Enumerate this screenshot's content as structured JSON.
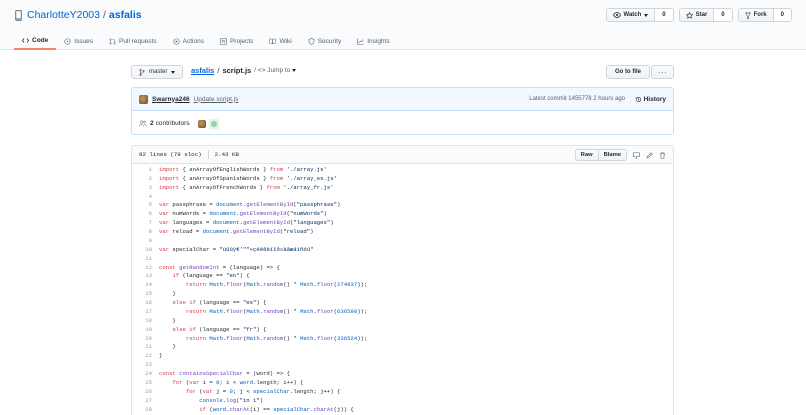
{
  "repo": {
    "owner": "CharlotteY2003",
    "separator": "/",
    "name": "asfalis"
  },
  "header_actions": [
    {
      "label": "Watch",
      "count": "0",
      "icon": "eye-icon",
      "caret": true
    },
    {
      "label": "Star",
      "count": "0",
      "icon": "star-icon",
      "caret": false
    },
    {
      "label": "Fork",
      "count": "0",
      "icon": "fork-icon",
      "caret": false
    }
  ],
  "tabs": [
    {
      "label": "Code",
      "icon": "code-icon",
      "selected": true
    },
    {
      "label": "Issues",
      "icon": "issue-icon",
      "selected": false
    },
    {
      "label": "Pull requests",
      "icon": "pull-request-icon",
      "selected": false
    },
    {
      "label": "Actions",
      "icon": "play-icon",
      "selected": false
    },
    {
      "label": "Projects",
      "icon": "project-icon",
      "selected": false
    },
    {
      "label": "Wiki",
      "icon": "book-icon",
      "selected": false
    },
    {
      "label": "Security",
      "icon": "shield-icon",
      "selected": false
    },
    {
      "label": "Insights",
      "icon": "graph-icon",
      "selected": false
    }
  ],
  "branch": {
    "name": "master"
  },
  "breadcrumb": {
    "repo": "asfalis",
    "sep": "/",
    "file": "script.js",
    "jump": "/ <> Jump to"
  },
  "goto_file": "Go to file",
  "more": "···",
  "commit": {
    "author": "Swarnya246",
    "message": "Update script.js",
    "latest": "Latest commit 1455778 2 hours ago",
    "history": "History"
  },
  "contributors": {
    "count": "2",
    "label": "contributors"
  },
  "file_info": {
    "lines": "92 lines (79 sloc)",
    "size": "2.43 KB"
  },
  "file_buttons": {
    "raw": "Raw",
    "blame": "Blame"
  },
  "code_lines": [
    {
      "n": "1",
      "text": "import { anArrayOfEnglishWords } from './array.js'"
    },
    {
      "n": "2",
      "text": "import { anArrayOfSpanishWords } from './array_es.js'"
    },
    {
      "n": "3",
      "text": "import { anArrayOfFrenchWords } from './array_fr.js'"
    },
    {
      "n": "4",
      "text": ""
    },
    {
      "n": "5",
      "text": "var passphrase = document.getElementById(\"passphrase\")"
    },
    {
      "n": "6",
      "text": "var numWords = document.getElementById(\"numWords\")"
    },
    {
      "n": "7",
      "text": "var languages = document.getElementById(\"languages\")"
    },
    {
      "n": "8",
      "text": "var reload = document.getElementById(\"reload\")"
    },
    {
      "n": "9",
      "text": ""
    },
    {
      "n": "10",
      "text": "var specialChar = \"ùûüÿ€'\"\"«çéèêëïîô»àâæáíñóú\""
    },
    {
      "n": "11",
      "text": ""
    },
    {
      "n": "12",
      "text": "const getRandomInt = (language) => {"
    },
    {
      "n": "13",
      "text": "    if (language == \"en\") {"
    },
    {
      "n": "14",
      "text": "        return Math.floor(Math.random() * Math.floor(274937));"
    },
    {
      "n": "15",
      "text": "    }"
    },
    {
      "n": "16",
      "text": "    else if (language == \"es\") {"
    },
    {
      "n": "17",
      "text": "        return Math.floor(Math.random() * Math.floor(636598));"
    },
    {
      "n": "18",
      "text": "    }"
    },
    {
      "n": "19",
      "text": "    else if (language == \"fr\") {"
    },
    {
      "n": "20",
      "text": "        return Math.floor(Math.random() * Math.floor(336524));"
    },
    {
      "n": "21",
      "text": "    }"
    },
    {
      "n": "22",
      "text": "}"
    },
    {
      "n": "23",
      "text": ""
    },
    {
      "n": "24",
      "text": "const containsSpecialChar = (word) => {"
    },
    {
      "n": "25",
      "text": "    for (var i = 0; i < word.length; i++) {"
    },
    {
      "n": "26",
      "text": "        for (var j = 0; j < specialChar.length; j++) {"
    },
    {
      "n": "27",
      "text": "            console.log(\"in i\")"
    },
    {
      "n": "28",
      "text": "            if (word.charAt(i) == specialChar.charAt(j)) {"
    }
  ]
}
